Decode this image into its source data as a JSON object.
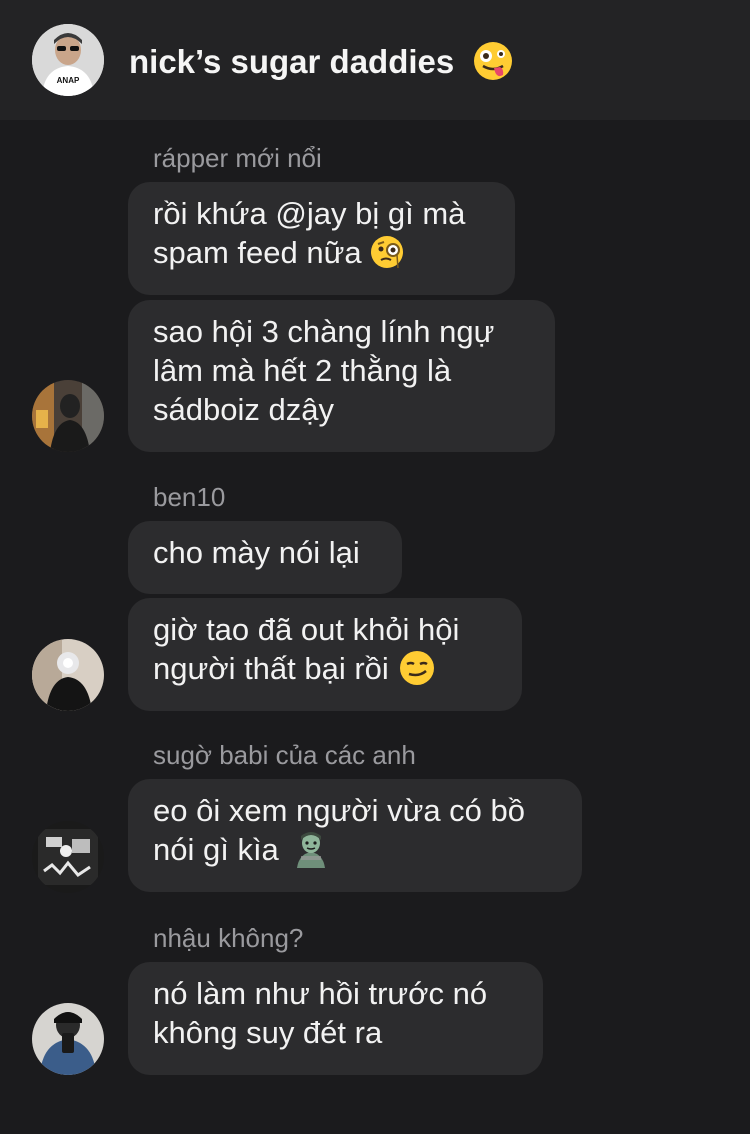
{
  "header": {
    "title": "nick’s sugar daddies",
    "title_emoji": "zany-face-emoji",
    "avatar_shirt_text": "ANAP"
  },
  "groups": [
    {
      "sender": "rápper mới nổi",
      "messages": [
        {
          "lines": [
            "rồi khứa @jay bị gì mà",
            "spam feed nữa"
          ],
          "emoji": "face-with-monocle-emoji"
        },
        {
          "lines": [
            "sao hội 3 chàng lính ngự",
            "lâm mà hết 2 thằng là",
            "sádboiz dzậy"
          ]
        }
      ]
    },
    {
      "sender": "ben10",
      "messages": [
        {
          "lines": [
            "cho mày nói lại"
          ]
        },
        {
          "lines": [
            "giờ tao đã out khỏi hội",
            "người thất bại rồi"
          ],
          "emoji": "smirking-face-emoji"
        }
      ]
    },
    {
      "sender": "sugờ babi của các anh",
      "messages": [
        {
          "lines": [
            "eo ôi xem người vừa có bồ",
            "nói gì kìa"
          ],
          "emoji": "zombie-emoji"
        }
      ]
    },
    {
      "sender": "nhậu không?",
      "messages": [
        {
          "lines": [
            "nó làm như hồi trước nó",
            "không suy đét ra"
          ]
        }
      ]
    }
  ],
  "colors": {
    "background": "#1b1b1d",
    "header": "#232325",
    "bubble": "#2c2c2e",
    "sender_text": "#9a9a9e"
  }
}
